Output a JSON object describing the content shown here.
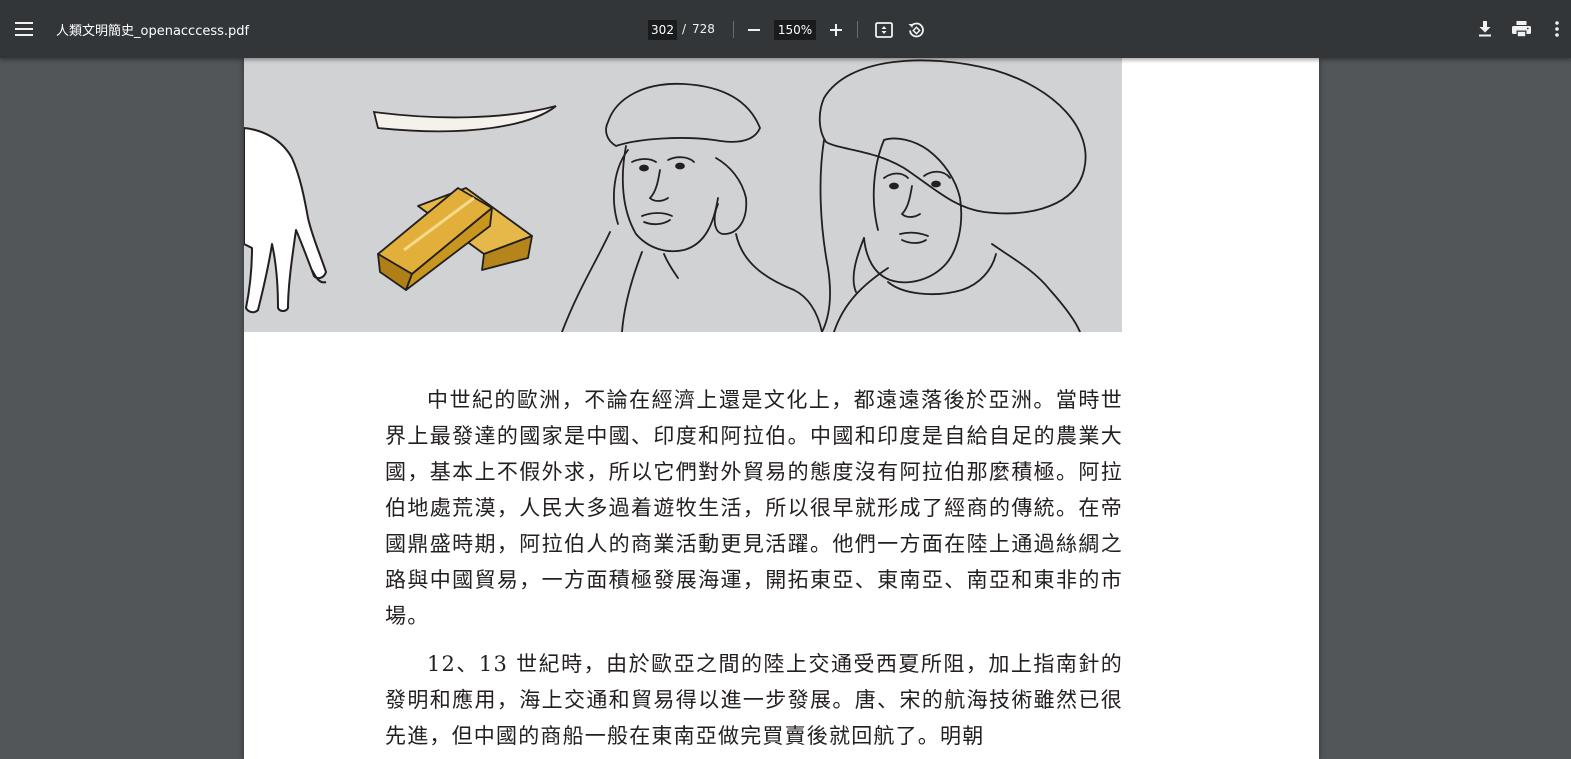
{
  "toolbar": {
    "menu_icon": "menu-icon",
    "title": "人類文明簡史_openacccess.pdf",
    "page_current": "302",
    "page_separator": "/",
    "page_total": "728",
    "zoom": "150%",
    "icons": [
      "zoom-out-icon",
      "zoom-in-icon",
      "fit-page-icon",
      "rotate-icon",
      "download-icon",
      "print-icon",
      "more-vert-icon"
    ]
  },
  "document": {
    "illustration": {
      "description_icons": [
        "horse-icon",
        "ivory-tusk-icon",
        "gold-bars-icon",
        "merchant-portrait-icon",
        "merchant-wide-hat-portrait-icon"
      ],
      "colors": {
        "background": "#d1d2d4",
        "gold": "#d4a52a",
        "tusk": "#f4f2ea"
      }
    },
    "paragraphs": [
      "中世紀的歐洲，不論在經濟上還是文化上，都遠遠落後於亞洲。當時世界上最發達的國家是中國、印度和阿拉伯。中國和印度是自給自足的農業大國，基本上不假外求，所以它們對外貿易的態度沒有阿拉伯那麼積極。阿拉伯地處荒漠，人民大多過着遊牧生活，所以很早就形成了經商的傳統。在帝國鼎盛時期，阿拉伯人的商業活動更見活躍。他們一方面在陸上通過絲綢之路與中國貿易，一方面積極發展海運，開拓東亞、東南亞、南亞和東非的市場。",
      "12、13 世紀時，由於歐亞之間的陸上交通受西夏所阻，加上指南針的發明和應用，海上交通和貿易得以進一步發展。唐、宋的航海技術雖然已很先進，但中國的商船一般在東南亞做完買賣後就回航了。明朝"
    ]
  }
}
